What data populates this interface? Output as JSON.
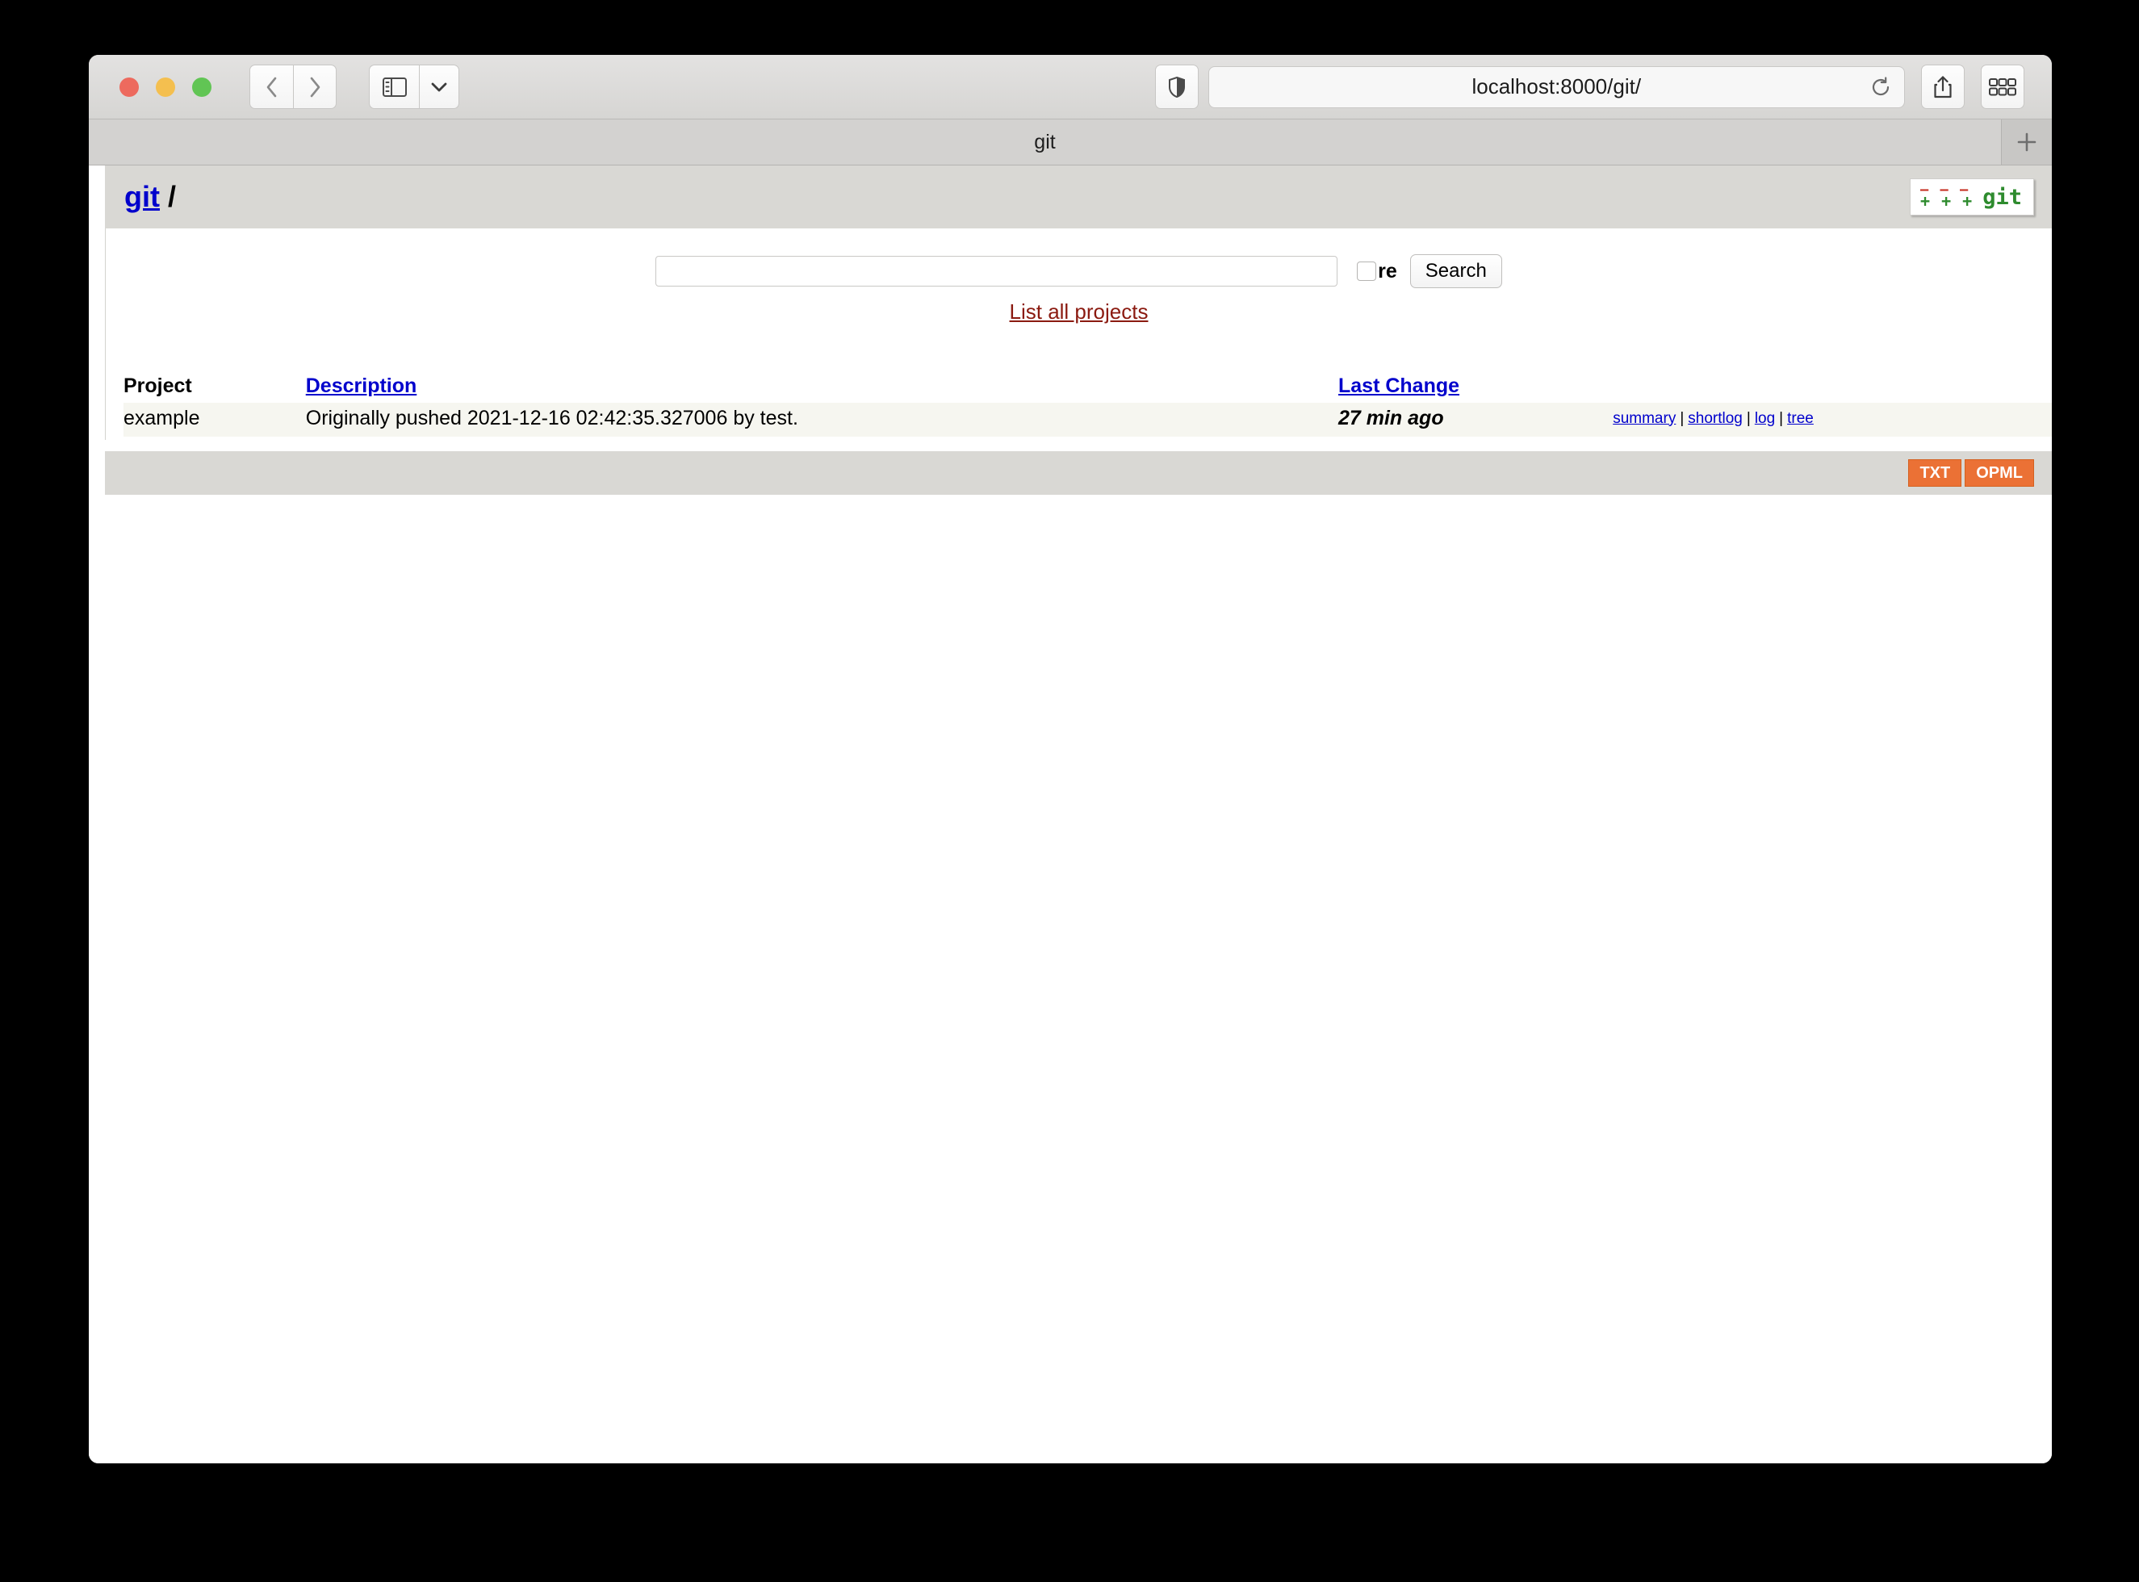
{
  "browser": {
    "window_controls": {
      "close": "close-button",
      "minimize": "minimize-button",
      "zoom": "zoom-button"
    },
    "back_label": "‹",
    "forward_label": "›",
    "url": "localhost:8000/git/",
    "tab_title": "git",
    "new_tab_label": "+"
  },
  "page": {
    "header": {
      "project_link": "git",
      "separator": "/",
      "logo": {
        "dashes": "– – –",
        "pluses": "+ + +",
        "word": "git"
      }
    },
    "search": {
      "input_value": "",
      "placeholder": "",
      "regexp_label": "re",
      "button_label": "Search",
      "list_all_label": "List all projects"
    },
    "table": {
      "headers": {
        "project": "Project",
        "description": "Description",
        "last_change": "Last Change"
      },
      "rows": [
        {
          "project": "example",
          "description": "Originally pushed 2021-12-16 02:42:35.327006 by test.",
          "age": "27 min ago",
          "links": [
            "summary",
            "shortlog",
            "log",
            "tree"
          ],
          "link_separator": "|"
        }
      ]
    },
    "footer": {
      "txt_label": "TXT",
      "opml_label": "OPML"
    }
  },
  "colors": {
    "link_blue": "#0000cc",
    "link_red": "#8b1a10",
    "age_green": "#2f8f2f",
    "feed_orange": "#eb7135",
    "header_gray": "#d9d8d4",
    "row_cream": "#f6f6f0"
  }
}
